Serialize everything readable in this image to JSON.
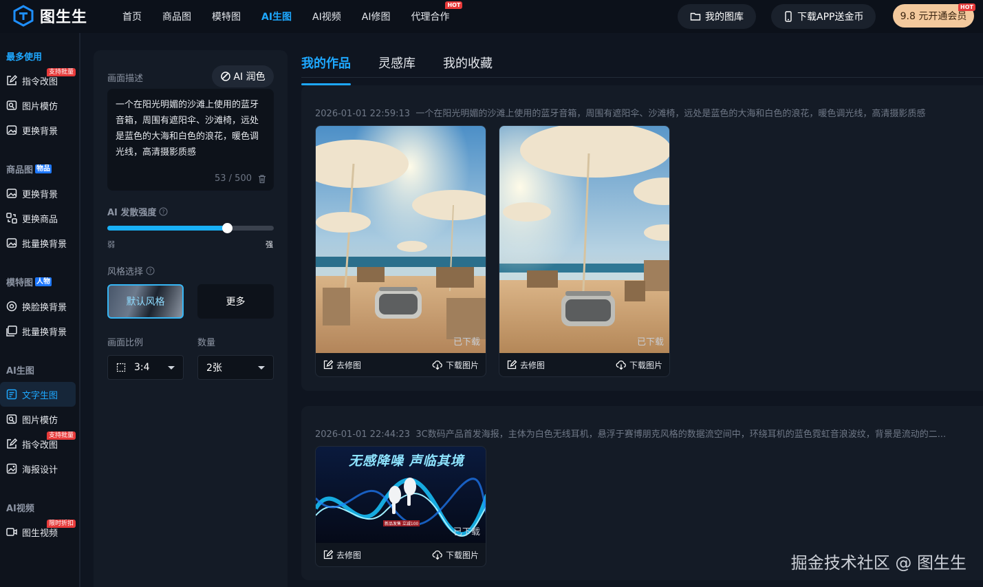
{
  "brand": {
    "name": "图生生"
  },
  "nav": [
    {
      "label": "首页"
    },
    {
      "label": "商品图"
    },
    {
      "label": "模特图"
    },
    {
      "label": "AI生图",
      "active": true
    },
    {
      "label": "AI视频"
    },
    {
      "label": "AI修图"
    },
    {
      "label": "代理合作",
      "badge": "HOT"
    }
  ],
  "top_actions": {
    "gallery": "我的图库",
    "download_app": "下载APP送金币",
    "vip": "9.8 元开通会员",
    "vip_badge": "HOT"
  },
  "sidebar": {
    "sections": [
      {
        "title": "最多使用",
        "tag": "",
        "items": [
          {
            "label": "指令改图",
            "badge": "支持批量"
          },
          {
            "label": "图片模仿"
          },
          {
            "label": "更换背景"
          }
        ]
      },
      {
        "title": "商品图",
        "tag": "物品",
        "items": [
          {
            "label": "更换背景"
          },
          {
            "label": "更换商品"
          },
          {
            "label": "批量换背景"
          }
        ]
      },
      {
        "title": "模特图",
        "tag": "人物",
        "items": [
          {
            "label": "换脸换背景"
          },
          {
            "label": "批量换背景"
          }
        ]
      },
      {
        "title": "AI生图",
        "tag": "",
        "items": [
          {
            "label": "文字生图",
            "active": true
          },
          {
            "label": "图片模仿"
          },
          {
            "label": "指令改图",
            "badge": "支持批量"
          },
          {
            "label": "海报设计"
          }
        ]
      },
      {
        "title": "AI视频",
        "tag": "",
        "items": [
          {
            "label": "图生视频",
            "badge": "限时折扣"
          }
        ]
      }
    ]
  },
  "panel": {
    "desc_label": "画面描述",
    "ai_polish": "AI 润色",
    "desc_text": "一个在阳光明媚的沙滩上使用的蓝牙音箱，周围有遮阳伞、沙滩椅，远处是蓝色的大海和白色的浪花，暖色调光线，高清摄影质感",
    "desc_count": "53 / 500",
    "strength_label": "AI 发散强度",
    "strength_value": 0.72,
    "strength_min": "弱",
    "strength_max": "强",
    "style_label": "风格选择",
    "style_default": "默认风格",
    "style_more": "更多",
    "ratio_label": "画面比例",
    "ratio_value": "3:4",
    "count_label": "数量",
    "count_value": "2张"
  },
  "tabs": [
    {
      "label": "我的作品",
      "active": true
    },
    {
      "label": "灵感库"
    },
    {
      "label": "我的收藏"
    }
  ],
  "works": [
    {
      "time": "2026-01-01 22:59:13",
      "prompt": "一个在阳光明媚的沙滩上使用的蓝牙音箱，周围有遮阳伞、沙滩椅，远处是蓝色的大海和白色的浪花，暖色调光线，高清摄影质感",
      "images": [
        {
          "status": "已下载",
          "edit": "去修图",
          "download": "下载图片"
        },
        {
          "status": "已下载",
          "edit": "去修图",
          "download": "下载图片"
        }
      ]
    },
    {
      "time": "2026-01-01 22:44:23",
      "prompt": "3C数码产品首发海报，主体为白色无线耳机，悬浮于赛博朋克风格的数据流空间中，环绕耳机的蓝色霓虹音浪波纹，背景是流动的二...",
      "images": [
        {
          "status": "已下载",
          "edit": "去修图",
          "download": "下载图片",
          "poster_title": "无感降噪 声临其境",
          "poster_note": "新品发售 立减100"
        }
      ]
    }
  ],
  "watermark": "掘金技术社区 @ 图生生",
  "colors": {
    "accent": "#1ea8ff",
    "hot": "#e73a3a",
    "vip": "#f3c99d"
  }
}
